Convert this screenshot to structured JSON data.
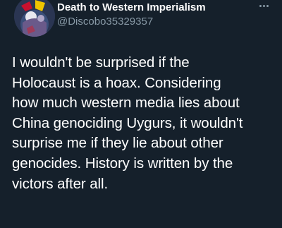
{
  "tweet": {
    "display_name": "Death to Western Imperialism",
    "handle": "@Discobo35329357",
    "more_icon": "more-horizontal-icon",
    "avatar_icon": "avatar-image",
    "text_lines": [
      "I wouldn't be surprised if the",
      "Holocaust is a hoax. Considering",
      "how much western media lies about",
      "China genociding Uygurs, it wouldn't",
      "surprise me if they lie about other",
      "genocides. History is written by the",
      "victors after all."
    ]
  },
  "colors": {
    "background": "#15202b",
    "text_primary": "#ffffff",
    "text_secondary": "#8899a6"
  }
}
